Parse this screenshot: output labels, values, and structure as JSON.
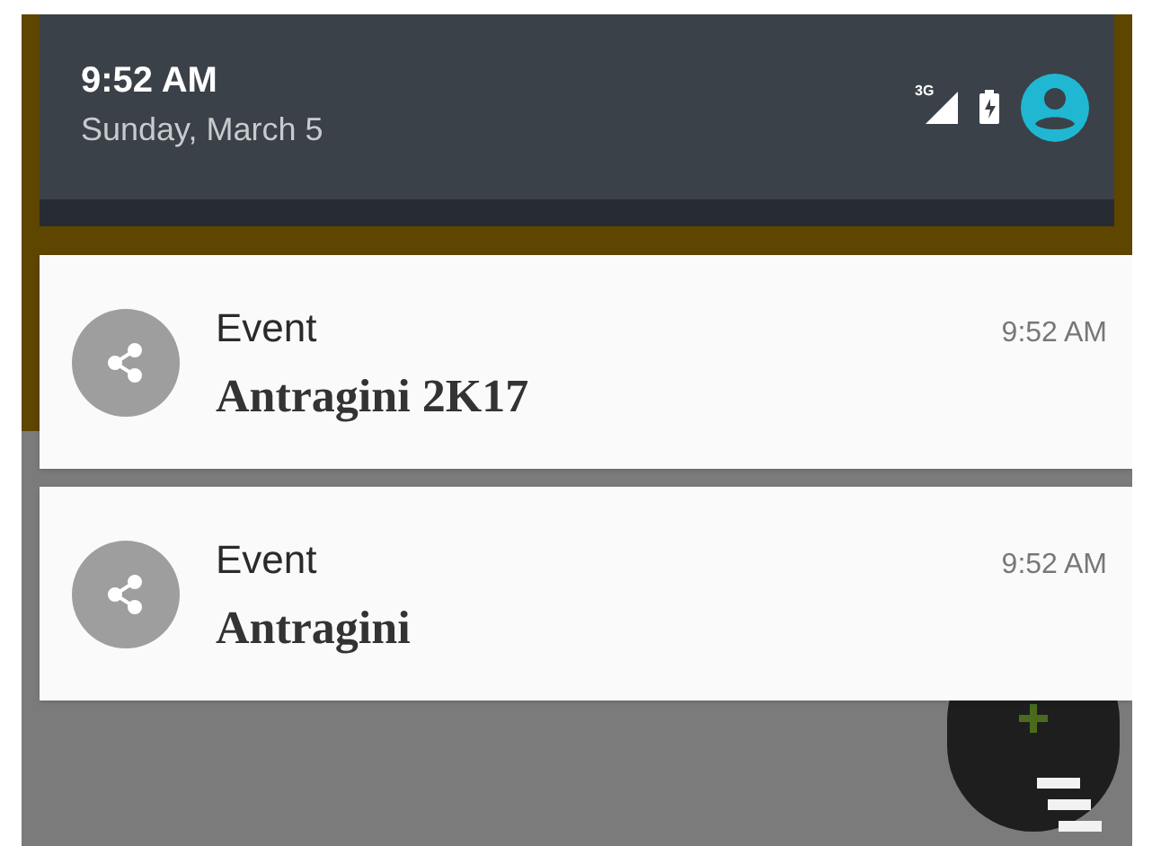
{
  "status": {
    "time": "9:52 AM",
    "date": "Sunday, March 5",
    "network": "3G"
  },
  "notifications": [
    {
      "app": "Event",
      "time": "9:52 AM",
      "text": "Antragini 2K17"
    },
    {
      "app": "Event",
      "time": "9:52 AM",
      "text": "Antragini"
    }
  ]
}
